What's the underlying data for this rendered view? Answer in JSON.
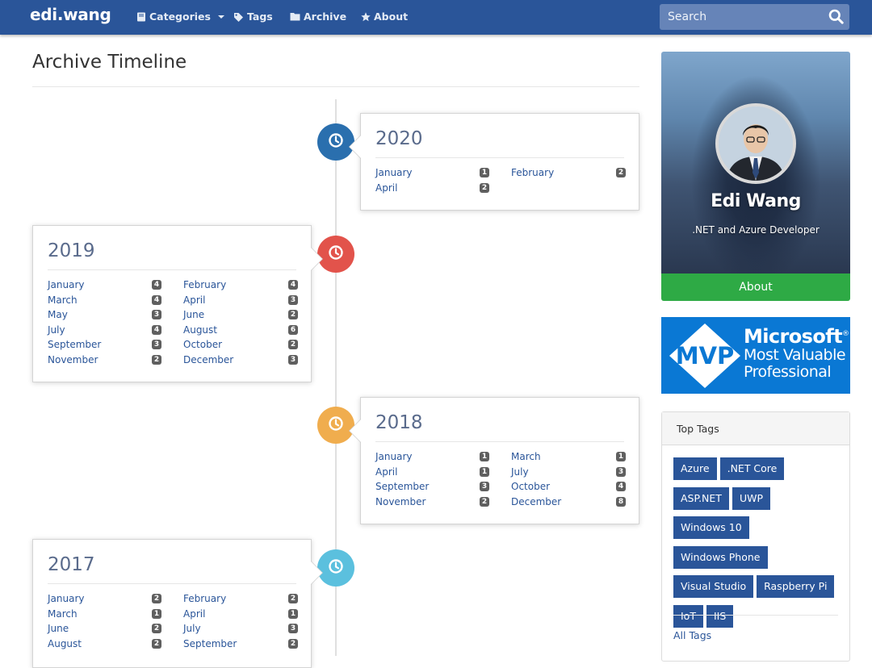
{
  "nav": {
    "brand": "edi.wang",
    "categories": "Categories",
    "tags": "Tags",
    "archive": "Archive",
    "about": "About",
    "search_placeholder": "Search",
    "bg_color": "#2a5599"
  },
  "page": {
    "title": "Archive Timeline"
  },
  "timeline": [
    {
      "year": "2020",
      "color": "#2a6fae",
      "months": [
        [
          "January",
          "1"
        ],
        [
          "February",
          "2"
        ],
        [
          "April",
          "2"
        ]
      ]
    },
    {
      "year": "2019",
      "color": "#e2534b",
      "months": [
        [
          "January",
          "4"
        ],
        [
          "February",
          "4"
        ],
        [
          "March",
          "4"
        ],
        [
          "April",
          "3"
        ],
        [
          "May",
          "3"
        ],
        [
          "June",
          "2"
        ],
        [
          "July",
          "4"
        ],
        [
          "August",
          "6"
        ],
        [
          "September",
          "3"
        ],
        [
          "October",
          "2"
        ],
        [
          "November",
          "2"
        ],
        [
          "December",
          "3"
        ]
      ]
    },
    {
      "year": "2018",
      "color": "#f0ad4e",
      "months": [
        [
          "January",
          "1"
        ],
        [
          "March",
          "1"
        ],
        [
          "April",
          "1"
        ],
        [
          "July",
          "3"
        ],
        [
          "September",
          "3"
        ],
        [
          "October",
          "4"
        ],
        [
          "November",
          "2"
        ],
        [
          "December",
          "8"
        ]
      ]
    },
    {
      "year": "2017",
      "color": "#5bc0de",
      "months": [
        [
          "January",
          "2"
        ],
        [
          "February",
          "2"
        ],
        [
          "March",
          "1"
        ],
        [
          "April",
          "1"
        ],
        [
          "June",
          "2"
        ],
        [
          "July",
          "3"
        ],
        [
          "August",
          "2"
        ],
        [
          "September",
          "2"
        ]
      ]
    }
  ],
  "sidebar": {
    "profile": {
      "name": "Edi Wang",
      "subtitle": ".NET and Azure Developer",
      "about_button": "About"
    },
    "mvp": {
      "badge": "MVP",
      "line1": "Microsoft",
      "registered": "®",
      "line2": "Most Valuable",
      "line3": "Professional"
    },
    "tags": {
      "heading": "Top Tags",
      "items": [
        "Azure",
        ".NET Core",
        "ASP.NET",
        "UWP",
        "Windows 10",
        "Windows Phone",
        "Visual Studio",
        "Raspberry Pi",
        "IoT",
        "IIS"
      ],
      "all_tags_link": "All Tags"
    }
  }
}
